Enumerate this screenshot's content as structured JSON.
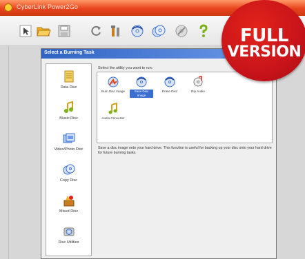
{
  "app": {
    "title": "CyberLink Power2Go"
  },
  "toolbar": {
    "buttons": [
      {
        "icon": "pointer-icon"
      },
      {
        "icon": "folder-open-icon"
      },
      {
        "icon": "save-icon"
      },
      {
        "icon": "refresh-icon"
      },
      {
        "icon": "tools-icon"
      },
      {
        "icon": "burn-disc-icon"
      },
      {
        "icon": "copy-disc-icon"
      },
      {
        "icon": "erase-disc-icon"
      },
      {
        "icon": "help-icon"
      }
    ]
  },
  "dialog": {
    "title": "Select a Burning Task",
    "prompt": "Select the utility you want to run:",
    "sidebar": [
      {
        "label": "Data Disc",
        "icon": "data-disc-icon"
      },
      {
        "label": "Music Disc",
        "icon": "music-disc-icon"
      },
      {
        "label": "Video/Photo Disc",
        "icon": "video-photo-disc-icon"
      },
      {
        "label": "Copy Disc",
        "icon": "copy-disc-icon"
      },
      {
        "label": "Mixed Disc",
        "icon": "mixed-disc-icon"
      },
      {
        "label": "Disc Utilities",
        "icon": "disc-utilities-icon"
      }
    ],
    "utilities": [
      {
        "label": "Burn Disc Image",
        "icon": "burn-disc-image-icon"
      },
      {
        "label": "Save Disc Image",
        "icon": "save-disc-image-icon",
        "selected": true
      },
      {
        "label": "Erase Disc",
        "icon": "erase-disc-icon"
      },
      {
        "label": "Rip Audio",
        "icon": "rip-audio-icon"
      },
      {
        "label": "Audio Converter",
        "icon": "audio-converter-icon"
      }
    ],
    "description": "Save a disc image onto your hard drive. This function is useful for backing up your disc onto your hard drive for future burning tasks."
  },
  "badge": {
    "line1": "FULL",
    "line2": "VERSION",
    "color": "#d11a1a"
  },
  "colors": {
    "title_bar": "#e8431c",
    "dialog_title": "#2f63c5",
    "selection": "#3a6fd0"
  }
}
